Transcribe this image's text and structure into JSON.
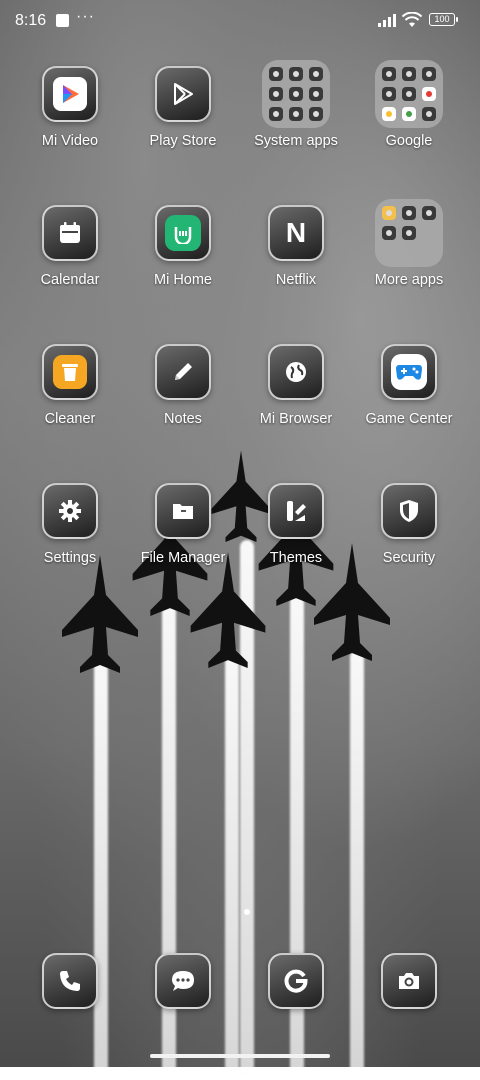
{
  "status_bar": {
    "time": "8:16",
    "overflow": "···",
    "battery": "100"
  },
  "apps": [
    {
      "label": "Mi Video",
      "icon": "mi-video-icon"
    },
    {
      "label": "Play Store",
      "icon": "play-store-icon"
    },
    {
      "label": "System apps",
      "icon": "folder-icon"
    },
    {
      "label": "Google",
      "icon": "folder-icon"
    },
    {
      "label": "Calendar",
      "icon": "calendar-icon"
    },
    {
      "label": "Mi Home",
      "icon": "mi-home-icon"
    },
    {
      "label": "Netflix",
      "icon": "netflix-icon"
    },
    {
      "label": "More apps",
      "icon": "folder-icon"
    },
    {
      "label": "Cleaner",
      "icon": "trash-icon"
    },
    {
      "label": "Notes",
      "icon": "pencil-icon"
    },
    {
      "label": "Mi Browser",
      "icon": "globe-icon"
    },
    {
      "label": "Game Center",
      "icon": "gamepad-icon"
    },
    {
      "label": "Settings",
      "icon": "gear-icon"
    },
    {
      "label": "File Manager",
      "icon": "folder-icon"
    },
    {
      "label": "Themes",
      "icon": "brush-icon"
    },
    {
      "label": "Security",
      "icon": "shield-icon"
    }
  ],
  "netflix_letter": "N",
  "dock": [
    {
      "icon": "phone-icon"
    },
    {
      "icon": "message-icon"
    },
    {
      "icon": "google-icon"
    },
    {
      "icon": "camera-icon"
    }
  ],
  "colors": {
    "accent_blue": "#1e88e5",
    "cleaner_orange": "#f5a623",
    "mi_home_green": "#22b573"
  },
  "wallpaper": "jets-black-and-white-icon"
}
